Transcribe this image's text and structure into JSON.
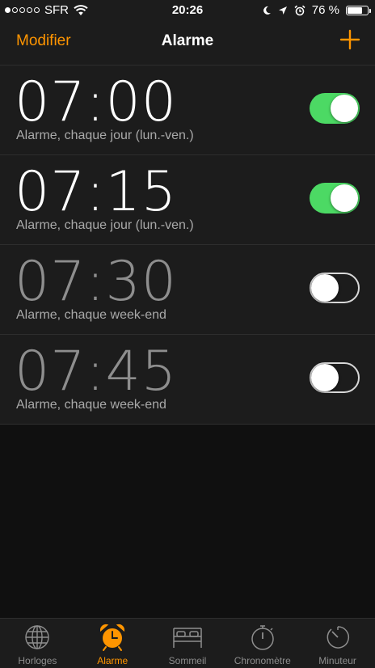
{
  "status_bar": {
    "carrier": "SFR",
    "time": "20:26",
    "battery": "76 %",
    "battery_level": 0.76
  },
  "nav": {
    "edit_label": "Modifier",
    "title": "Alarme",
    "add_icon": "plus-icon"
  },
  "alarms": [
    {
      "time": "07:00",
      "label": "Alarme, chaque jour (lun.-ven.)",
      "enabled": true
    },
    {
      "time": "07:15",
      "label": "Alarme, chaque jour (lun.-ven.)",
      "enabled": true
    },
    {
      "time": "07:30",
      "label": "Alarme, chaque week-end",
      "enabled": false
    },
    {
      "time": "07:45",
      "label": "Alarme, chaque week-end",
      "enabled": false
    }
  ],
  "tabs": [
    {
      "label": "Horloges",
      "icon": "globe-icon",
      "active": false
    },
    {
      "label": "Alarme",
      "icon": "alarm-clock-icon",
      "active": true
    },
    {
      "label": "Sommeil",
      "icon": "bed-icon",
      "active": false
    },
    {
      "label": "Chronomètre",
      "icon": "stopwatch-icon",
      "active": false
    },
    {
      "label": "Minuteur",
      "icon": "timer-icon",
      "active": false
    }
  ],
  "colors": {
    "accent": "#ff9500",
    "toggle_on": "#4cd964",
    "background": "#101010",
    "surface": "#1c1c1c"
  }
}
